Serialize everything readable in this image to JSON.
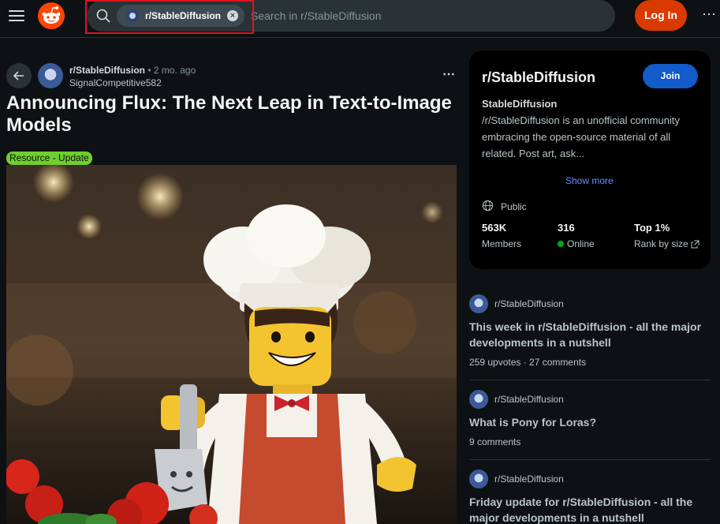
{
  "header": {
    "search_chip": "r/StableDiffusion",
    "search_placeholder": "Search in r/StableDiffusion",
    "login_label": "Log In",
    "more_label": "⋯"
  },
  "post": {
    "subreddit": "r/StableDiffusion",
    "separator": " • ",
    "time": "2 mo. ago",
    "author": "SignalCompetitive582",
    "more_label": "⋯",
    "title": "Announcing Flux: The Next Leap in Text-to-Image Models",
    "flair": "Resource - Update"
  },
  "community": {
    "title": "r/StableDiffusion",
    "join_label": "Join",
    "name": "StableDiffusion",
    "description": "/r/StableDiffusion is an unofficial community embracing the open-source material of all related. Post art, ask...",
    "show_more": "Show more",
    "visibility": "Public",
    "stats": [
      {
        "value": "563K",
        "label": "Members"
      },
      {
        "value": "316",
        "label": "Online"
      },
      {
        "value": "Top 1%",
        "label": "Rank by size"
      }
    ]
  },
  "related": [
    {
      "subreddit": "r/StableDiffusion",
      "title": "This week in r/StableDiffusion - all the major developments in a nutshell",
      "meta": "259 upvotes · 27 comments"
    },
    {
      "subreddit": "r/StableDiffusion",
      "title": "What is Pony for Loras?",
      "meta": "9 comments"
    },
    {
      "subreddit": "r/StableDiffusion",
      "title": "Friday update for r/StableDiffusion - all the major developments in a nutshell",
      "meta": ""
    }
  ]
}
